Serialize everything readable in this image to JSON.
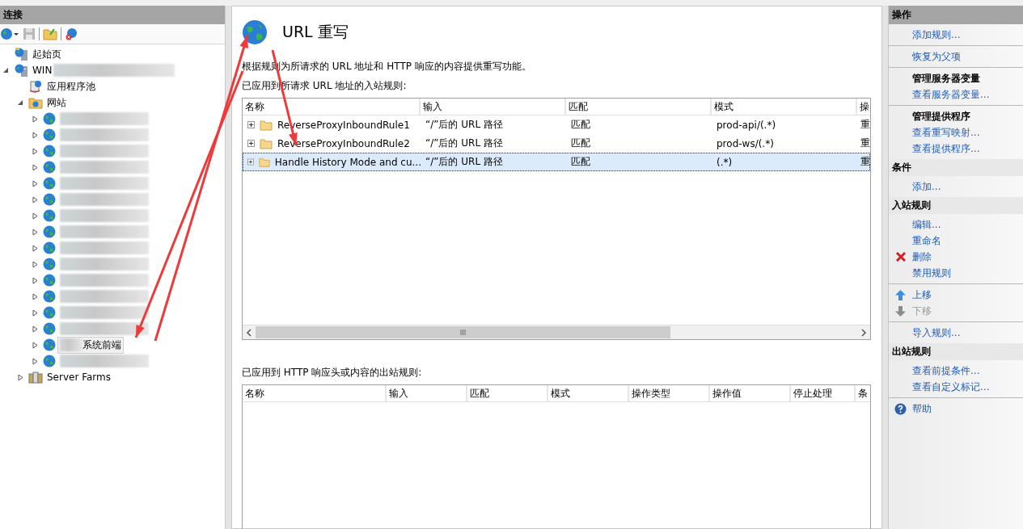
{
  "connections": {
    "title": "连接",
    "tree": [
      {
        "label": "起始页",
        "kind": "start"
      },
      {
        "label": "WIN",
        "kind": "server",
        "redacted": true,
        "expanded": true,
        "children": [
          {
            "label": "应用程序池",
            "kind": "pool"
          },
          {
            "label": "网站",
            "kind": "sites",
            "expanded": true,
            "children": [
              {
                "kind": "site",
                "redacted": true,
                "expanded": false,
                "selected": false
              },
              {
                "kind": "site",
                "redacted": true,
                "expanded": false,
                "selected": false
              },
              {
                "kind": "site",
                "redacted": true,
                "expanded": false,
                "selected": false
              },
              {
                "kind": "site",
                "redacted": true,
                "expanded": false,
                "selected": false
              },
              {
                "kind": "site",
                "redacted": true,
                "expanded": false,
                "selected": false
              },
              {
                "kind": "site",
                "redacted": true,
                "expanded": false,
                "selected": false
              },
              {
                "kind": "site",
                "redacted": true,
                "expanded": false,
                "selected": false
              },
              {
                "kind": "site",
                "redacted": true,
                "expanded": false,
                "selected": false
              },
              {
                "kind": "site",
                "redacted": true,
                "expanded": false,
                "selected": false
              },
              {
                "kind": "site",
                "redacted": true,
                "expanded": false,
                "selected": false
              },
              {
                "kind": "site",
                "redacted": true,
                "expanded": false,
                "selected": false
              },
              {
                "kind": "site",
                "redacted": true,
                "expanded": false,
                "selected": false
              },
              {
                "kind": "site",
                "redacted": true,
                "expanded": false,
                "selected": false
              },
              {
                "kind": "site",
                "redacted": true,
                "expanded": false,
                "selected": false
              },
              {
                "label": "系统前端",
                "kind": "site",
                "redacted": true,
                "expanded": false,
                "selected": true
              },
              {
                "kind": "site",
                "redacted": true,
                "expanded": false,
                "selected": false
              }
            ]
          },
          {
            "label": "Server Farms",
            "kind": "farm",
            "expanded": false
          }
        ]
      }
    ]
  },
  "feature": {
    "title": "URL 重写",
    "description": "根据规则为所请求的 URL 地址和 HTTP 响应的内容提供重写功能。",
    "inbound": {
      "label": "已应用到所请求 URL 地址的入站规则:",
      "columns": [
        "名称",
        "输入",
        "匹配",
        "模式",
        "操"
      ],
      "rows": [
        {
          "cells": [
            "ReverseProxyInboundRule1",
            "“/”后的 URL 路径",
            "匹配",
            "prod-api/(.*)",
            "重"
          ],
          "selected": false
        },
        {
          "cells": [
            "ReverseProxyInboundRule2",
            "“/”后的 URL 路径",
            "匹配",
            "prod-ws/(.*)",
            "重"
          ],
          "selected": false
        },
        {
          "cells": [
            "Handle History Mode and cu...",
            "“/”后的 URL 路径",
            "匹配",
            "(.*)",
            "重"
          ],
          "selected": true
        }
      ]
    },
    "outbound": {
      "label": "已应用到 HTTP 响应头或内容的出站规则:",
      "columns": [
        "名称",
        "输入",
        "匹配",
        "模式",
        "操作类型",
        "操作值",
        "停止处理",
        "条"
      ]
    }
  },
  "actions": {
    "title": "操作",
    "sections": [
      {
        "groups": [
          [
            {
              "label": "添加规则...",
              "kind": "link"
            }
          ],
          [
            {
              "label": "恢复为父项",
              "kind": "link"
            }
          ],
          [
            {
              "label": "管理服务器变量",
              "kind": "title"
            },
            {
              "label": "查看服务器变量...",
              "kind": "link"
            }
          ],
          [
            {
              "label": "管理提供程序",
              "kind": "title"
            },
            {
              "label": "查看重写映射...",
              "kind": "link"
            },
            {
              "label": "查看提供程序...",
              "kind": "link"
            }
          ]
        ]
      },
      {
        "title": "条件",
        "groups": [
          [
            {
              "label": "添加...",
              "kind": "link"
            }
          ]
        ]
      },
      {
        "title": "入站规则",
        "groups": [
          [
            {
              "label": "编辑...",
              "kind": "link"
            },
            {
              "label": "重命名",
              "kind": "link"
            },
            {
              "label": "删除",
              "kind": "delete"
            },
            {
              "label": "禁用规则",
              "kind": "link"
            }
          ],
          [
            {
              "label": "上移",
              "kind": "up",
              "disabled": false
            },
            {
              "label": "下移",
              "kind": "down",
              "disabled": true
            }
          ],
          [
            {
              "label": "导入规则...",
              "kind": "link"
            }
          ]
        ]
      },
      {
        "title": "出站规则",
        "groups": [
          [
            {
              "label": "查看前提条件...",
              "kind": "link"
            },
            {
              "label": "查看自定义标记...",
              "kind": "link"
            }
          ],
          [
            {
              "label": "帮助",
              "kind": "help"
            }
          ]
        ]
      }
    ]
  }
}
